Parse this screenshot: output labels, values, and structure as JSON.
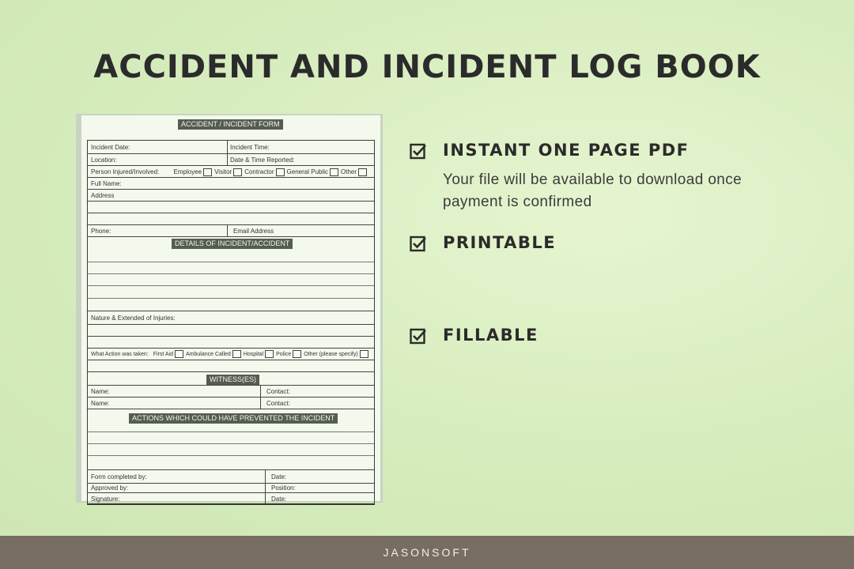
{
  "title": "ACCIDENT AND INCIDENT LOG BOOK",
  "footer_brand": "JASONSOFT",
  "form": {
    "header": "ACCIDENT / INCIDENT FORM",
    "incident_date": "Incident Date:",
    "incident_time": "Incident Time:",
    "location": "Location:",
    "date_time_reported": "Date & Time Reported:",
    "person_injured": "Person Injured/Involved:",
    "person_options": [
      "Employee",
      "Visitor",
      "Contractor",
      "General Public",
      "Other"
    ],
    "full_name": "Full Name:",
    "address": "Address",
    "phone": "Phone:",
    "email": "Email Address",
    "details_header": "DETAILS OF INCIDENT/ACCIDENT",
    "nature_injuries": "Nature & Extended of Injuries:",
    "action_taken": "What Action was taken:",
    "action_options": [
      "First Aid",
      "Ambulance Called",
      "Hospital",
      "Police",
      "Other (please specify)"
    ],
    "witness_header": "WITNESS(ES)",
    "witness_name_1": "Name:",
    "witness_contact_1": "Contact:",
    "witness_name_2": "Name:",
    "witness_contact_2": "Contact:",
    "prevent_header": "ACTIONS WHICH COULD HAVE PREVENTED THE INCIDENT",
    "completed_by": "Form completed by:",
    "completed_date": "Date:",
    "approved_by": "Approved by:",
    "approved_position": "Position:",
    "signature": "Signature:",
    "signature_date": "Date:"
  },
  "features": [
    {
      "icon": "checkbox-checked-icon",
      "title": "INSTANT ONE PAGE PDF",
      "description": "Your file will be available to download once payment is confirmed"
    },
    {
      "icon": "checkbox-checked-icon",
      "title": "PRINTABLE",
      "description": ""
    },
    {
      "icon": "checkbox-checked-icon",
      "title": "FILLABLE",
      "description": ""
    }
  ],
  "colors": {
    "background": "#d9eec0",
    "footer": "#786d62",
    "header_fill": "#545d4e",
    "text": "#2b2b2b"
  }
}
